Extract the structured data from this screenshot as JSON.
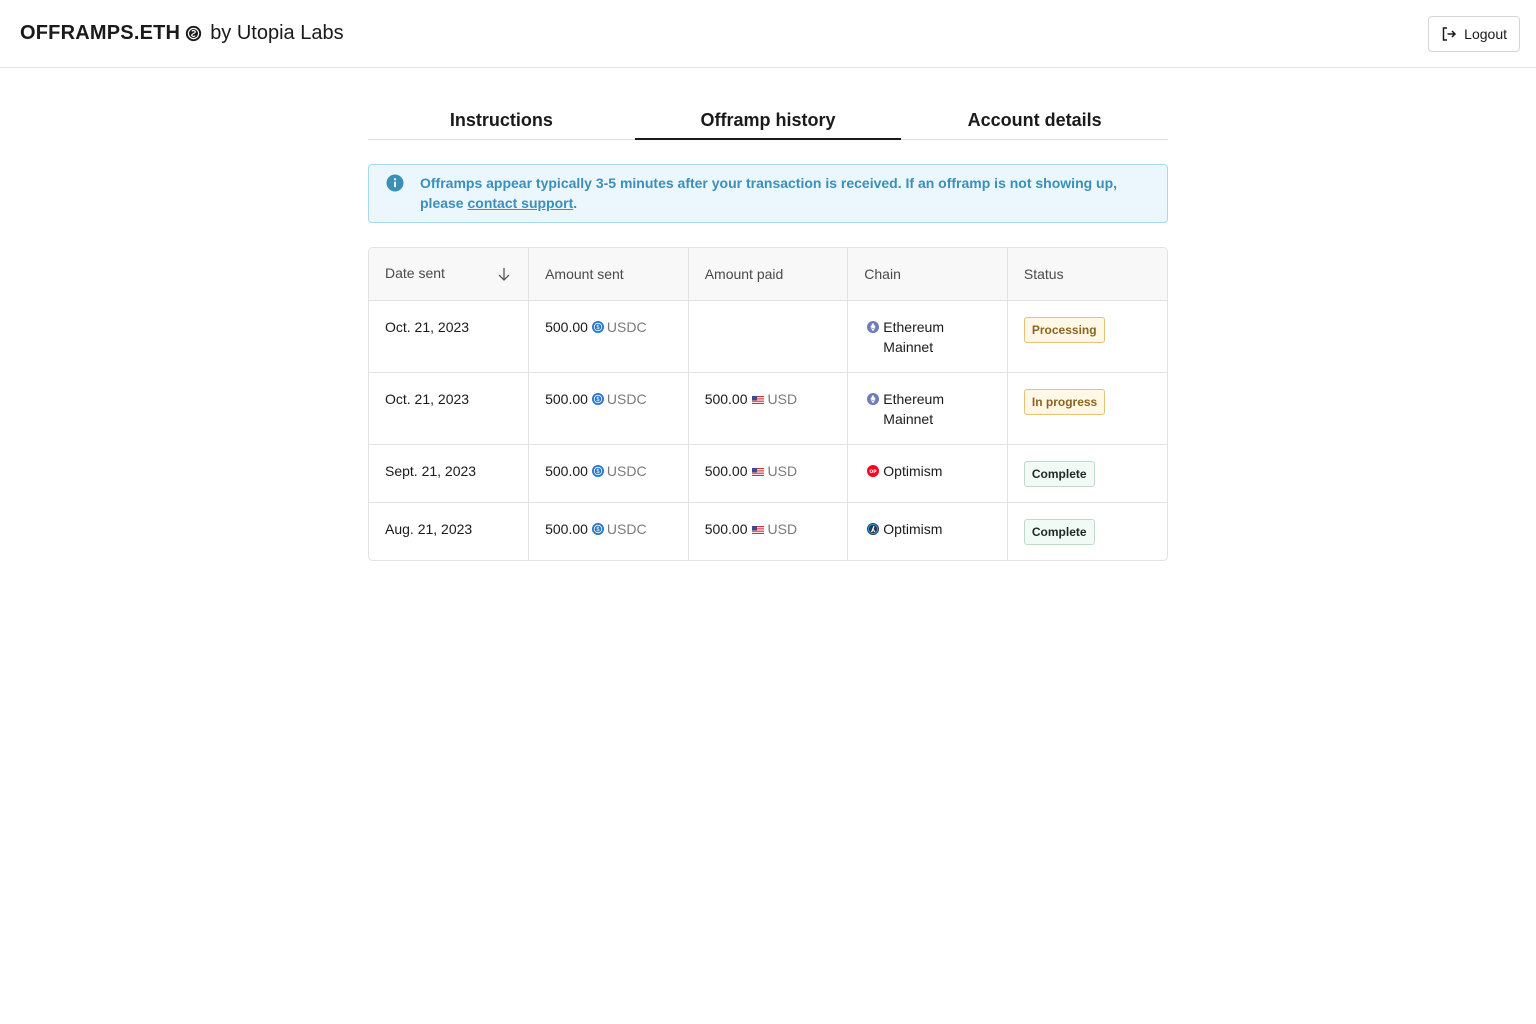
{
  "header": {
    "brand_name": "OFFRAMPS.ETH",
    "brand_by": "by Utopia Labs",
    "logout_label": "Logout"
  },
  "tabs": [
    {
      "label": "Instructions",
      "active": false
    },
    {
      "label": "Offramp history",
      "active": true
    },
    {
      "label": "Account details",
      "active": false
    }
  ],
  "alert": {
    "text_before": "Offramps appear typically 3-5 minutes after your transaction is received. If an offramp is not showing up, please ",
    "link_text": "contact support",
    "text_after": "."
  },
  "table": {
    "columns": [
      "Date sent",
      "Amount sent",
      "Amount paid",
      "Chain",
      "Status"
    ],
    "rows": [
      {
        "date": "Oct. 21, 2023",
        "sent_amount": "500.00",
        "sent_unit": "USDC",
        "paid_amount": "",
        "paid_unit": "",
        "chain_line1": "Ethereum",
        "chain_line2": "Mainnet",
        "chain_icon": "ethereum-icon",
        "status": "Processing",
        "status_kind": "warn"
      },
      {
        "date": "Oct. 21, 2023",
        "sent_amount": "500.00",
        "sent_unit": "USDC",
        "paid_amount": "500.00",
        "paid_unit": "USD",
        "chain_line1": "Ethereum",
        "chain_line2": "Mainnet",
        "chain_icon": "ethereum-icon",
        "status": "In progress",
        "status_kind": "warn"
      },
      {
        "date": "Sept. 21, 2023",
        "sent_amount": "500.00",
        "sent_unit": "USDC",
        "paid_amount": "500.00",
        "paid_unit": "USD",
        "chain_line1": "Optimism",
        "chain_line2": "",
        "chain_icon": "optimism-icon",
        "status": "Complete",
        "status_kind": "ok"
      },
      {
        "date": "Aug. 21, 2023",
        "sent_amount": "500.00",
        "sent_unit": "USDC",
        "paid_amount": "500.00",
        "paid_unit": "USD",
        "chain_line1": "Optimism",
        "chain_line2": "",
        "chain_icon": "arbitrum-icon",
        "status": "Complete",
        "status_kind": "ok"
      }
    ]
  },
  "colors": {
    "accent_info": "#3b8fb8",
    "warn_border": "#e7c07a",
    "ok_border": "#bfdccb",
    "optimism_red": "#ff0420",
    "ethereum_purple": "#6f7cba",
    "usdc_blue": "#2775ca"
  }
}
